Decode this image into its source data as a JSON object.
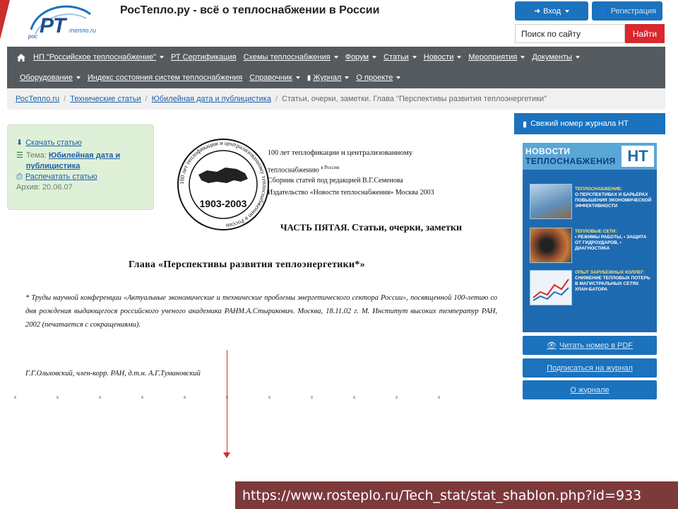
{
  "header": {
    "site_title": "РосТепло.ру - всё о теплоснабжении в России",
    "logo_text": "РТ",
    "logo_sub": "тепло.ru",
    "logo_left": "рос",
    "login_label": "Вход",
    "register_label": "Регистрация",
    "search_placeholder": "Поиск по сайту",
    "search_button": "Найти",
    "accent_color": "#d9272e",
    "primary_color": "#1b72bd"
  },
  "nav": {
    "row1": [
      {
        "label": "НП \"Российское теплоснабжение\"",
        "dropdown": true
      },
      {
        "label": "РТ Сертификация",
        "dropdown": false
      },
      {
        "label": "Схемы теплоснабжения",
        "dropdown": true
      },
      {
        "label": "Форум",
        "dropdown": true
      },
      {
        "label": "Статьи",
        "dropdown": true
      },
      {
        "label": "Новости",
        "dropdown": true
      },
      {
        "label": "Мероприятия",
        "dropdown": true
      },
      {
        "label": "Документы",
        "dropdown": true
      }
    ],
    "row2": [
      {
        "label": "Оборудование",
        "dropdown": true
      },
      {
        "label": "Индекс состояния систем теплоснабжения",
        "dropdown": false
      },
      {
        "label": "Справочник",
        "dropdown": true
      },
      {
        "label": "Журнал",
        "dropdown": true
      },
      {
        "label": "О проекте",
        "dropdown": true
      }
    ]
  },
  "breadcrumb": {
    "items": [
      "РосТепло.ru",
      "Технические статьи",
      "Юбилейная дата и публицистика"
    ],
    "current": "Статьи, очерки, заметки. Глава \"Перспективы развития теплоэнергетики\""
  },
  "info": {
    "download_label": "Скачать статью",
    "theme_label": "Тема:",
    "theme_value": "Юбилейная дата и публицистика",
    "print_label": "Распечатать статью",
    "archive_label": "Архив: 20.06.07"
  },
  "document": {
    "seal_year": "1903-2003",
    "seal_ring": "100 лет теплофикации и централизованному теплоснабжению в России",
    "line1a": "100 лет",
    "line1b": "теплофикации и централизованному",
    "line2a": "теплоснабжению",
    "line2b": "в России",
    "line3": "Сборник статей под редакцией В.Г.Семенова",
    "line4": "Издательство «Новости теплоснабжения» Москва 2003",
    "part_a": "ЧАСТЬ ПЯТАЯ.",
    "part_b": "Статьи, очерки, заметки",
    "chapter": "Глава «Перспективы развития теплоэнергетики*»",
    "note": "* Труды научной конференции «Актуальные экономические и технические проблемы энергетического сектора России», посвященной 100-летию со дня рождения выдающегося российского ученого академика РАНМ.А.Стырикович. Москва, 18.11.02 г. М. Институт высоких температур РАН, 2002 (печатается с сокращениями).",
    "authors": "Г.Г.Ольховский, член-корр. РАН, д.т.н. А.Г.Тумановский"
  },
  "sidebar": {
    "journal_header": "Свежий номер журнала НТ",
    "cover": {
      "title_line1": "НОВОСТИ",
      "title_line2": "ТЕПЛОСНАБЖЕНИЯ",
      "brand": "НТ",
      "block1_title": "Теплоснабжение:",
      "block1_text": "о перспективах и барьерах повышения экономической эффективности",
      "block2_title": "Тепловые сети:",
      "block2_text": "• режимы работы, • защита от гидроударов, • диагностика",
      "block3_title": "Опыт зарубежных коллег:",
      "block3_text": "снижение тепловых потерь в магистральных сетях Улан-Батора"
    },
    "read_pdf": "Читать номер в PDF",
    "subscribe": "Подписаться на журнал",
    "about": "О журнале"
  },
  "url_banner": "https://www.rosteplo.ru/Tech_stat/stat_shablon.php?id=933"
}
